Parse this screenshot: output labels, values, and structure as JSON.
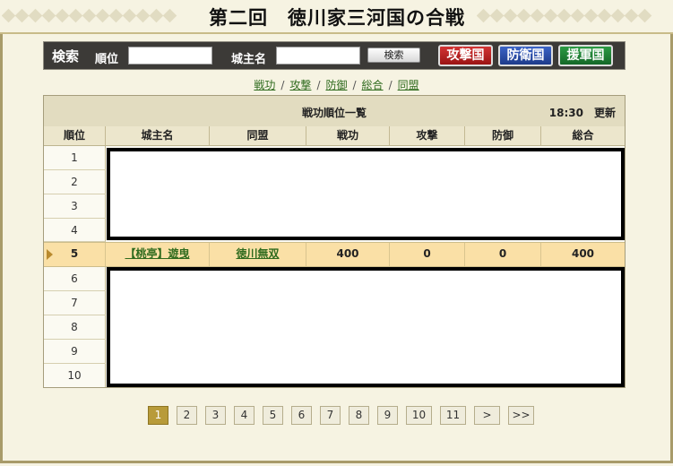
{
  "title": "第二回　徳川家三河国の合戦",
  "search": {
    "label": "検索",
    "rank_label": "順位",
    "rank_value": "",
    "lord_label": "城主名",
    "lord_value": "",
    "button": "検索"
  },
  "nation_buttons": {
    "attack": "攻撃国",
    "defend": "防衛国",
    "support": "援軍国"
  },
  "sort_links": [
    "戦功",
    "攻撃",
    "防御",
    "総合",
    "同盟"
  ],
  "sort_separator": "/",
  "table": {
    "caption": "戦功順位一覧",
    "update": "18:30　更新",
    "columns": [
      "順位",
      "城主名",
      "同盟",
      "戦功",
      "攻撃",
      "防御",
      "総合"
    ],
    "ranks": [
      "1",
      "2",
      "3",
      "4",
      "5",
      "6",
      "7",
      "8",
      "9",
      "10"
    ],
    "highlight": {
      "rank": "5",
      "lord": "【桃亭】遊曳",
      "alliance": "徳川無双",
      "merit": "400",
      "attack": "0",
      "defense": "0",
      "total": "400"
    }
  },
  "pagination": [
    "1",
    "2",
    "3",
    "4",
    "5",
    "6",
    "7",
    "8",
    "9",
    "10",
    "11",
    ">",
    ">>"
  ],
  "pagination_active": "1",
  "colors": {
    "attack": "#b21e1e",
    "defend": "#2a4ba8",
    "support": "#1f8236",
    "highlight_row": "#fae0a6"
  }
}
